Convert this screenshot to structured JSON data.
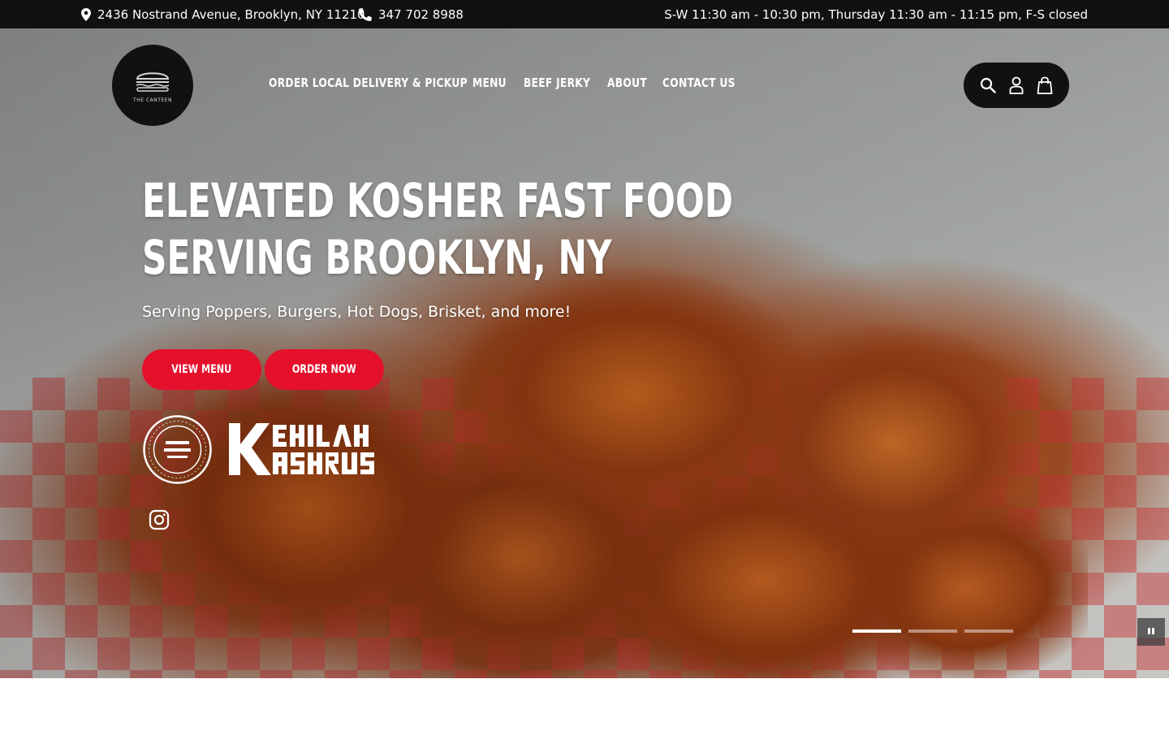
{
  "topbar": {
    "address": "2436 Nostrand Avenue, Brooklyn, NY 11210",
    "phone": "347 702 8988",
    "hours": "S-W 11:30 am - 10:30 pm, Thursday 11:30 am - 11:15 pm, F-S closed"
  },
  "header": {
    "logo_text": "THE CANTEEN",
    "nav": [
      {
        "label": "Order Local Delivery & Pickup"
      },
      {
        "label": "Menu"
      },
      {
        "label": "Beef Jerky"
      },
      {
        "label": "About"
      },
      {
        "label": "Contact Us"
      }
    ],
    "icons": [
      "search-icon",
      "account-icon",
      "cart-icon"
    ]
  },
  "hero": {
    "title_line1": "Elevated Kosher Fast Food",
    "title_line2": "Serving Brooklyn, NY",
    "subtitle": "Serving Poppers, Burgers, Hot Dogs, Brisket, and more!",
    "buttons": [
      {
        "label": "View Menu"
      },
      {
        "label": "Order Now"
      }
    ],
    "certification_logo": "KEHILAH KASHRUS",
    "social_icon": "instagram-icon",
    "slides": {
      "count": 3,
      "active": 1
    }
  },
  "colors": {
    "topbar_bg": "#111111",
    "accent_red": "#e5102c",
    "text_white": "#ffffff"
  }
}
